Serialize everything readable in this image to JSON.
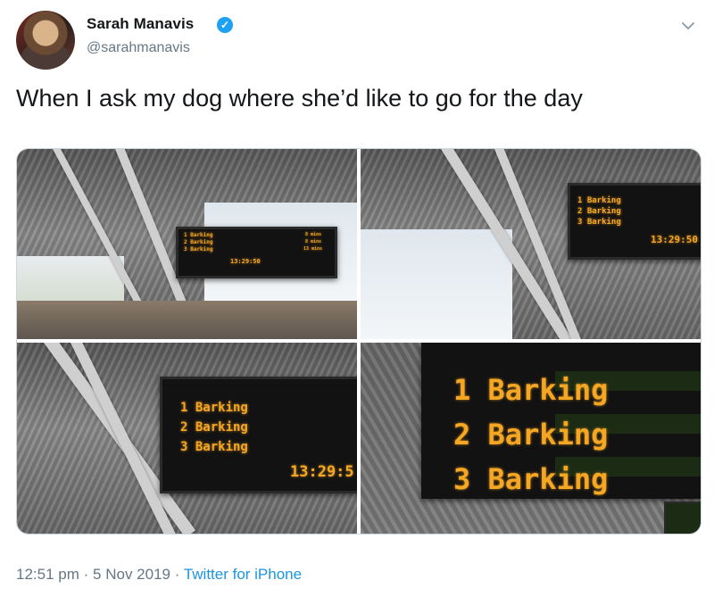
{
  "author": {
    "name": "Sarah Manavis",
    "handle": "@sarahmanavis",
    "verified_icon": "✓"
  },
  "tweet": {
    "text": "When I ask my dog where she’d like to go for the day"
  },
  "media": {
    "boards": [
      {
        "rows": [
          "1 Barking",
          "2 Barking",
          "3 Barking"
        ],
        "times": [
          "8 mins",
          "8 mins",
          "13 mins"
        ],
        "clock": "13:29:50"
      },
      {
        "rows": [
          "1 Barking",
          "2 Barking",
          "3 Barking"
        ],
        "clock": "13:29:50"
      },
      {
        "rows": [
          "1 Barking",
          "2 Barking",
          "3 Barking"
        ],
        "clock": "13:29:5"
      },
      {
        "rows": [
          "1 Barking",
          "2 Barking",
          "3 Barking"
        ]
      }
    ]
  },
  "footer": {
    "time": "12:51 pm",
    "separator": "·",
    "date": "5 Nov 2019",
    "source": "Twitter for iPhone"
  },
  "colors": {
    "verified": "#1da1f2",
    "link": "#1b95e0",
    "led": "#f5a623",
    "secondary_text": "#657786"
  },
  "icons": {
    "more": "chevron-down-icon",
    "verified": "verified-badge-icon"
  }
}
